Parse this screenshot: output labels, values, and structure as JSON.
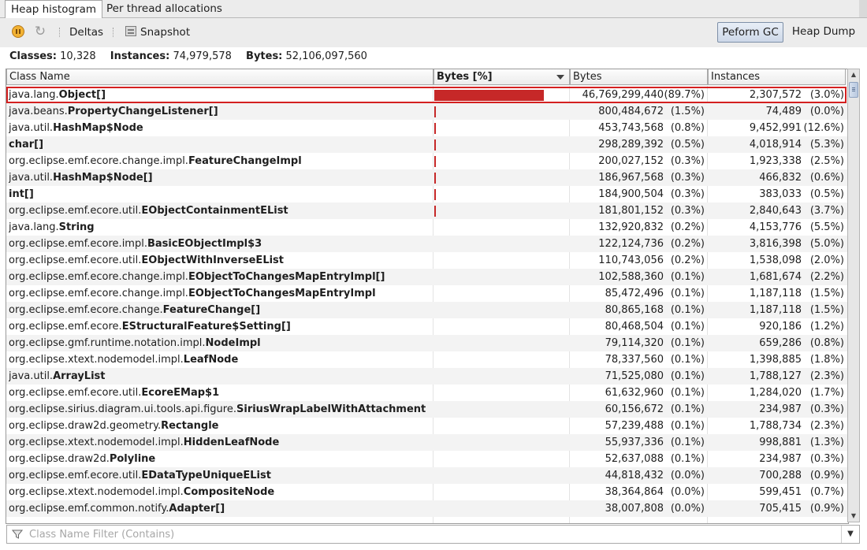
{
  "tabs": [
    {
      "label": "Heap histogram",
      "active": true
    },
    {
      "label": "Per thread allocations",
      "active": false
    }
  ],
  "toolbar": {
    "pause_icon": "pause-icon",
    "refresh_icon": "refresh-icon",
    "deltas_label": "Deltas",
    "snapshot_label": "Snapshot",
    "gc_label": "Peform GC",
    "heapdump_label": "Heap Dump"
  },
  "summary": {
    "classes_label": "Classes:",
    "classes_value": "10,328",
    "instances_label": "Instances:",
    "instances_value": "74,979,578",
    "bytes_label": "Bytes:",
    "bytes_value": "52,106,097,560"
  },
  "table": {
    "columns": [
      "Class Name",
      "Bytes [%]",
      "Bytes",
      "Instances"
    ],
    "sorted_column": "Bytes [%]",
    "bar_color": "#c62828",
    "rows": [
      {
        "pkg": "java.lang.",
        "cls": "Object[]",
        "bytes": "46,769,299,440",
        "bytes_pct": "(89.7%)",
        "inst": "2,307,572",
        "inst_pct": "(3.0%)",
        "share": 89.7
      },
      {
        "pkg": "java.beans.",
        "cls": "PropertyChangeListener[]",
        "bytes": "800,484,672",
        "bytes_pct": "(1.5%)",
        "inst": "74,489",
        "inst_pct": "(0.0%)",
        "share": 1.5
      },
      {
        "pkg": "java.util.",
        "cls": "HashMap$Node",
        "bytes": "453,743,568",
        "bytes_pct": "(0.8%)",
        "inst": "9,452,991",
        "inst_pct": "(12.6%)",
        "share": 0.8
      },
      {
        "pkg": "",
        "cls": "char[]",
        "bytes": "298,289,392",
        "bytes_pct": "(0.5%)",
        "inst": "4,018,914",
        "inst_pct": "(5.3%)",
        "share": 0.5
      },
      {
        "pkg": "org.eclipse.emf.ecore.change.impl.",
        "cls": "FeatureChangeImpl",
        "bytes": "200,027,152",
        "bytes_pct": "(0.3%)",
        "inst": "1,923,338",
        "inst_pct": "(2.5%)",
        "share": 0.3
      },
      {
        "pkg": "java.util.",
        "cls": "HashMap$Node[]",
        "bytes": "186,967,568",
        "bytes_pct": "(0.3%)",
        "inst": "466,832",
        "inst_pct": "(0.6%)",
        "share": 0.3
      },
      {
        "pkg": "",
        "cls": "int[]",
        "bytes": "184,900,504",
        "bytes_pct": "(0.3%)",
        "inst": "383,033",
        "inst_pct": "(0.5%)",
        "share": 0.3
      },
      {
        "pkg": "org.eclipse.emf.ecore.util.",
        "cls": "EObjectContainmentEList",
        "bytes": "181,801,152",
        "bytes_pct": "(0.3%)",
        "inst": "2,840,643",
        "inst_pct": "(3.7%)",
        "share": 0.3
      },
      {
        "pkg": "java.lang.",
        "cls": "String",
        "bytes": "132,920,832",
        "bytes_pct": "(0.2%)",
        "inst": "4,153,776",
        "inst_pct": "(5.5%)",
        "share": 0
      },
      {
        "pkg": "org.eclipse.emf.ecore.impl.",
        "cls": "BasicEObjectImpl$3",
        "bytes": "122,124,736",
        "bytes_pct": "(0.2%)",
        "inst": "3,816,398",
        "inst_pct": "(5.0%)",
        "share": 0
      },
      {
        "pkg": "org.eclipse.emf.ecore.util.",
        "cls": "EObjectWithInverseEList",
        "bytes": "110,743,056",
        "bytes_pct": "(0.2%)",
        "inst": "1,538,098",
        "inst_pct": "(2.0%)",
        "share": 0
      },
      {
        "pkg": "org.eclipse.emf.ecore.change.impl.",
        "cls": "EObjectToChangesMapEntryImpl[]",
        "bytes": "102,588,360",
        "bytes_pct": "(0.1%)",
        "inst": "1,681,674",
        "inst_pct": "(2.2%)",
        "share": 0
      },
      {
        "pkg": "org.eclipse.emf.ecore.change.impl.",
        "cls": "EObjectToChangesMapEntryImpl",
        "bytes": "85,472,496",
        "bytes_pct": "(0.1%)",
        "inst": "1,187,118",
        "inst_pct": "(1.5%)",
        "share": 0
      },
      {
        "pkg": "org.eclipse.emf.ecore.change.",
        "cls": "FeatureChange[]",
        "bytes": "80,865,168",
        "bytes_pct": "(0.1%)",
        "inst": "1,187,118",
        "inst_pct": "(1.5%)",
        "share": 0
      },
      {
        "pkg": "org.eclipse.emf.ecore.",
        "cls": "EStructuralFeature$Setting[]",
        "bytes": "80,468,504",
        "bytes_pct": "(0.1%)",
        "inst": "920,186",
        "inst_pct": "(1.2%)",
        "share": 0
      },
      {
        "pkg": "org.eclipse.gmf.runtime.notation.impl.",
        "cls": "NodeImpl",
        "bytes": "79,114,320",
        "bytes_pct": "(0.1%)",
        "inst": "659,286",
        "inst_pct": "(0.8%)",
        "share": 0
      },
      {
        "pkg": "org.eclipse.xtext.nodemodel.impl.",
        "cls": "LeafNode",
        "bytes": "78,337,560",
        "bytes_pct": "(0.1%)",
        "inst": "1,398,885",
        "inst_pct": "(1.8%)",
        "share": 0
      },
      {
        "pkg": "java.util.",
        "cls": "ArrayList",
        "bytes": "71,525,080",
        "bytes_pct": "(0.1%)",
        "inst": "1,788,127",
        "inst_pct": "(2.3%)",
        "share": 0
      },
      {
        "pkg": "org.eclipse.emf.ecore.util.",
        "cls": "EcoreEMap$1",
        "bytes": "61,632,960",
        "bytes_pct": "(0.1%)",
        "inst": "1,284,020",
        "inst_pct": "(1.7%)",
        "share": 0
      },
      {
        "pkg": "org.eclipse.sirius.diagram.ui.tools.api.figure.",
        "cls": "SiriusWrapLabelWithAttachment",
        "bytes": "60,156,672",
        "bytes_pct": "(0.1%)",
        "inst": "234,987",
        "inst_pct": "(0.3%)",
        "share": 0
      },
      {
        "pkg": "org.eclipse.draw2d.geometry.",
        "cls": "Rectangle",
        "bytes": "57,239,488",
        "bytes_pct": "(0.1%)",
        "inst": "1,788,734",
        "inst_pct": "(2.3%)",
        "share": 0
      },
      {
        "pkg": "org.eclipse.xtext.nodemodel.impl.",
        "cls": "HiddenLeafNode",
        "bytes": "55,937,336",
        "bytes_pct": "(0.1%)",
        "inst": "998,881",
        "inst_pct": "(1.3%)",
        "share": 0
      },
      {
        "pkg": "org.eclipse.draw2d.",
        "cls": "Polyline",
        "bytes": "52,637,088",
        "bytes_pct": "(0.1%)",
        "inst": "234,987",
        "inst_pct": "(0.3%)",
        "share": 0
      },
      {
        "pkg": "org.eclipse.emf.ecore.util.",
        "cls": "EDataTypeUniqueEList",
        "bytes": "44,818,432",
        "bytes_pct": "(0.0%)",
        "inst": "700,288",
        "inst_pct": "(0.9%)",
        "share": 0
      },
      {
        "pkg": "org.eclipse.xtext.nodemodel.impl.",
        "cls": "CompositeNode",
        "bytes": "38,364,864",
        "bytes_pct": "(0.0%)",
        "inst": "599,451",
        "inst_pct": "(0.7%)",
        "share": 0
      },
      {
        "pkg": "org.eclipse.emf.common.notify.",
        "cls": "Adapter[]",
        "bytes": "38,007,808",
        "bytes_pct": "(0.0%)",
        "inst": "705,415",
        "inst_pct": "(0.9%)",
        "share": 0
      }
    ]
  },
  "filter": {
    "placeholder": "Class Name Filter (Contains)",
    "icon": "filter-icon"
  }
}
